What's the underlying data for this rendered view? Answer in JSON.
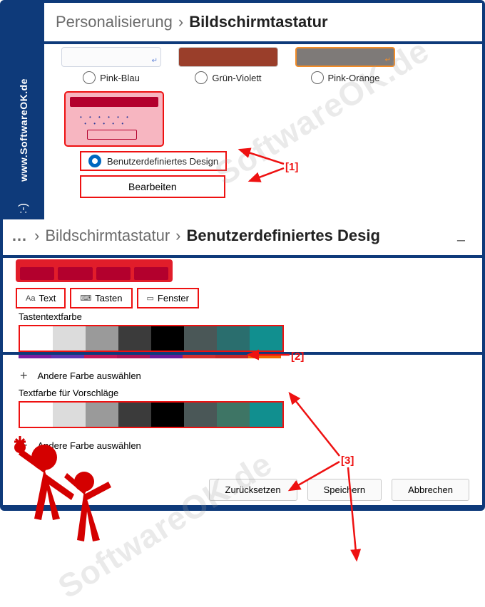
{
  "sidebar": {
    "url": "www.SoftwareOK.de",
    "smile": ":-)"
  },
  "breadcrumb1": {
    "parent": "Personalisierung",
    "sep": "›",
    "current": "Bildschirmtastatur"
  },
  "themes": {
    "pinkblue": "Pink-Blau",
    "greenviolet": "Grün-Violett",
    "pinkorange": "Pink-Orange",
    "custom": "Benutzerdefiniertes Design",
    "edit": "Bearbeiten"
  },
  "breadcrumb2": {
    "dots": "…",
    "sep": "›",
    "parent": "Bildschirmtastatur",
    "current": "Benutzerdefiniertes Desig"
  },
  "tabs": {
    "text": "Text",
    "keys": "Tasten",
    "window": "Fenster",
    "textIcon": "Aa",
    "keysIcon": "⌨",
    "windowIcon": "▭"
  },
  "sections": {
    "keytextcolor": "Tastentextfarbe",
    "suggestcolor": "Textfarbe für Vorschläge",
    "choose": "Andere Farbe auswählen"
  },
  "colors": {
    "row1": [
      "#ffffff",
      "#dcdcdc",
      "#9a9a9a",
      "#3b3b3b",
      "#000000",
      "#4a5757",
      "#2a6e6e",
      "#118f8f"
    ],
    "stripe": [
      "#7a1fa2",
      "#5e35b1",
      "#c2185b",
      "#ad1457",
      "#6a1b9a",
      "#d32f2f",
      "#c62828",
      "#ef6c00"
    ],
    "row2": [
      "#ffffff",
      "#dcdcdc",
      "#9a9a9a",
      "#3b3b3b",
      "#000000",
      "#4a5757",
      "#3e7565",
      "#118f8f"
    ]
  },
  "buttons": {
    "reset": "Zurücksetzen",
    "save": "Speichern",
    "cancel": "Abbrechen"
  },
  "annotations": {
    "a1": "[1]",
    "a2": "[2]",
    "a3": "[3]"
  },
  "watermark": "SoftwareOK.de"
}
